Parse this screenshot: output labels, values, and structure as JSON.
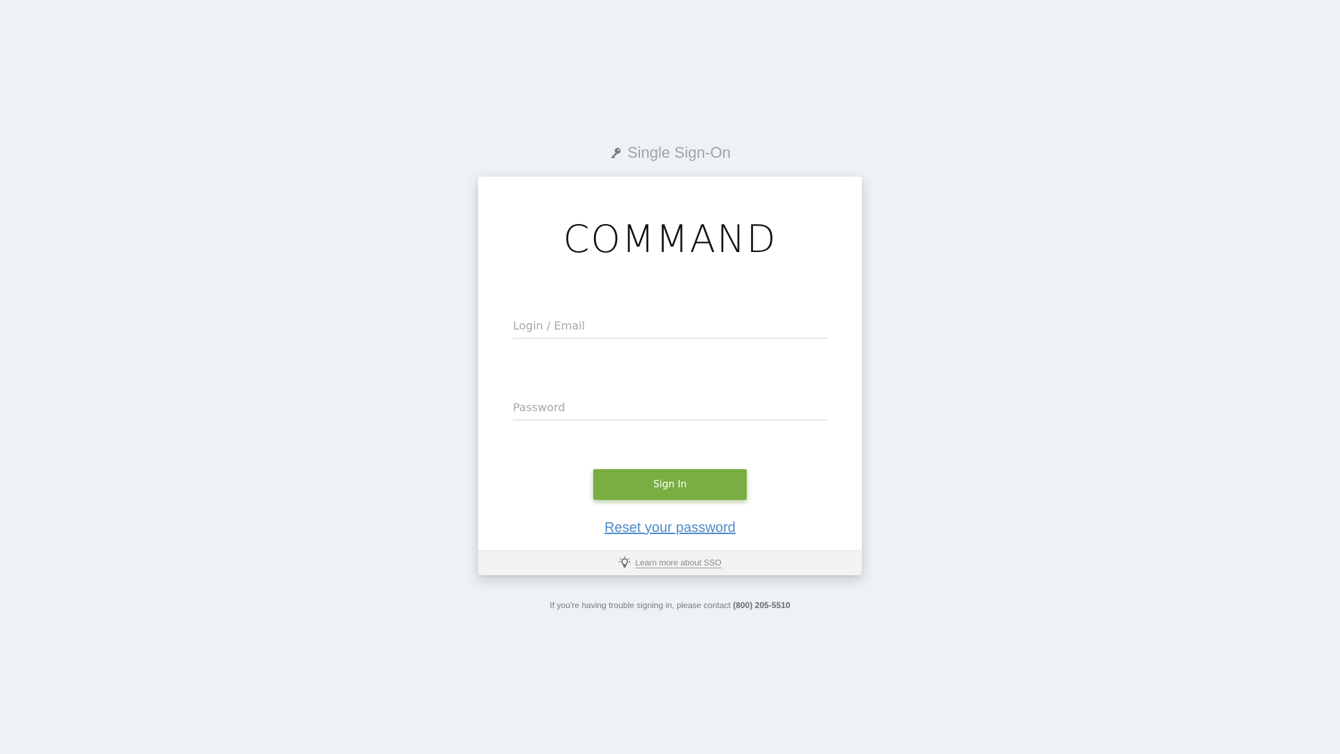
{
  "header": {
    "title": "Single Sign-On",
    "icon": "key-icon"
  },
  "card": {
    "logo_text": "COMMAND",
    "login_placeholder": "Login / Email",
    "login_value": "",
    "password_placeholder": "Password",
    "password_value": "",
    "signin_label": "Sign In",
    "reset_label": "Reset your password",
    "footer": {
      "icon": "lightbulb-icon",
      "learn_label": "Learn more about SSO"
    }
  },
  "support": {
    "text": "If you're having trouble signing in, please contact",
    "phone": "(800) 205-5510"
  },
  "colors": {
    "background": "#eef2f5",
    "accent_green": "#79ae43",
    "link_blue": "#4d8bc9"
  }
}
